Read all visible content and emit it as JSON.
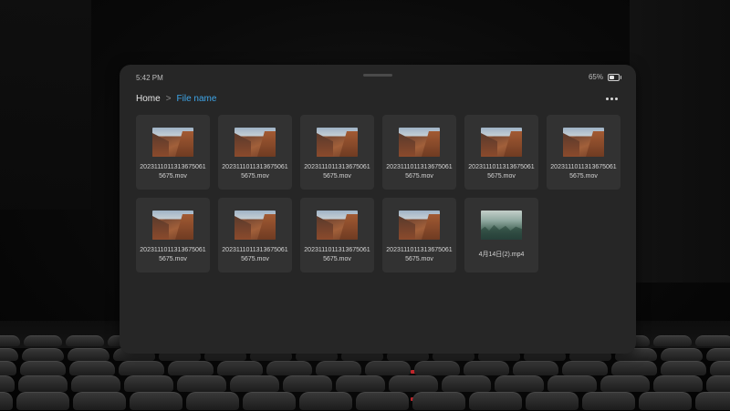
{
  "status_bar": {
    "time": "5:42 PM",
    "battery_percent": "65%",
    "battery_level": 0.65
  },
  "breadcrumb": {
    "home": "Home",
    "separator": ">",
    "current": "File name"
  },
  "menu": {
    "icon": "more-vertical-dots-icon"
  },
  "files": [
    {
      "line1": "20231110113136750",
      "line2": "615675.mov",
      "thumb": "canyon",
      "label": "2023111011313675061 5675.mov"
    },
    {
      "line1": "2023111011313675061",
      "line2": "5675.mov",
      "thumb": "canyon"
    },
    {
      "line1": "2023111011313675061",
      "line2": "5675.mov",
      "thumb": "canyon"
    },
    {
      "line1": "2023111011313675061",
      "line2": "5675.mov",
      "thumb": "canyon"
    },
    {
      "line1": "2023111011313675061",
      "line2": "5675.mov",
      "thumb": "canyon"
    },
    {
      "line1": "2023111011313675061",
      "line2": "5675.mov",
      "thumb": "canyon"
    },
    {
      "line1": "2023111011313675061",
      "line2": "5675.mov",
      "thumb": "canyon"
    },
    {
      "line1": "2023111011313675061",
      "line2": "5675.mov",
      "thumb": "canyon"
    },
    {
      "line1": "2023111011313675061",
      "line2": "5675.mov",
      "thumb": "canyon"
    },
    {
      "line1": "2023111011313675061",
      "line2": "5675.mov",
      "thumb": "canyon"
    },
    {
      "line1": "4月14日(2).mp4",
      "line2": "",
      "thumb": "forest"
    }
  ],
  "colors": {
    "panel": "#262626",
    "tile": "#323232",
    "accent": "#3ea5e8",
    "aisle_light": "#c0262b"
  }
}
